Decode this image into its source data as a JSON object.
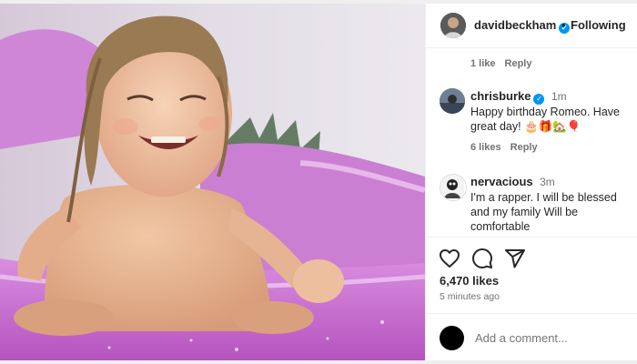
{
  "post": {
    "author": "davidbeckham",
    "follow_status": "Following",
    "separator": "•",
    "first_reply_meta": {
      "likes": "1 like",
      "reply": "Reply"
    }
  },
  "comments": [
    {
      "user": "chrisburke",
      "verified": true,
      "time": "1m",
      "text": "Happy birthday Romeo. Have great day! 🎂🎁🏡🎈",
      "likes": "6 likes",
      "reply": "Reply"
    },
    {
      "user": "nervacious",
      "verified": false,
      "time": "3m",
      "text": "I'm a rapper. I will be blessed and my family Will be comfortable"
    }
  ],
  "actions": {
    "icons": [
      "heart-icon",
      "comment-icon",
      "share-icon"
    ]
  },
  "likes_count": "6,470 likes",
  "posted_ago": "5 minutes ago",
  "add_comment": {
    "placeholder": "Add a comment..."
  },
  "colors": {
    "verified": "#0095f6",
    "pool": "#c86fd0"
  }
}
